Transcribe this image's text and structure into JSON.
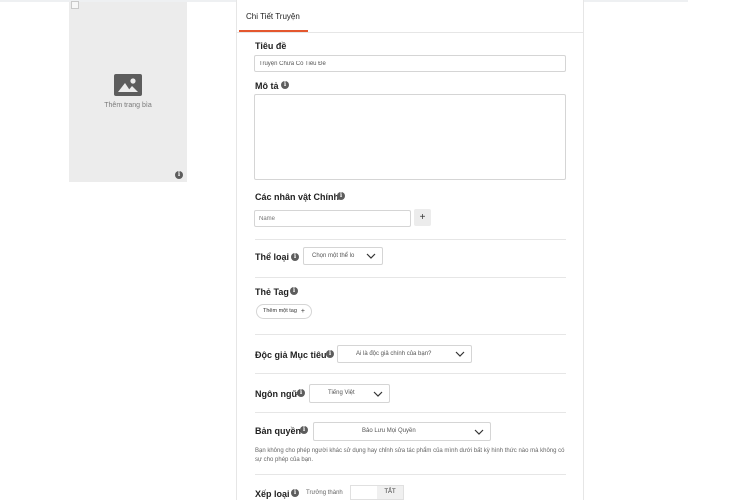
{
  "cover": {
    "add_cover_label": "Thêm trang bìa",
    "icon": "image-icon"
  },
  "tabs": [
    {
      "label": "Chi Tiết Truyện",
      "active": true
    }
  ],
  "form": {
    "title_label": "Tiêu đề",
    "title_value": "Truyện Chưa Có Tiêu Đề",
    "description_label": "Mô tả",
    "characters_label": "Các nhân vật Chính",
    "characters_placeholder": "Name",
    "add_character": "+",
    "genre_label": "Thể loại",
    "genre_value": "Chọn một thể lo",
    "tags_label": "Thẻ Tag",
    "add_tag_label": "Thêm một tag",
    "add_tag_plus": "+",
    "audience_label": "Độc giả Mục tiêu",
    "audience_value": "Ai là độc giả chính của bạn?",
    "language_label": "Ngôn ngữ",
    "language_value": "Tiếng Việt",
    "copyright_label": "Bản quyền",
    "copyright_value": "Bảo Lưu Mọi Quyền",
    "copyright_help": "Bạn không cho phép người khác sử dụng hay chỉnh sửa tác phẩm của mình dưới bất kỳ hình thức nào mà không có sự cho phép của bạn.",
    "rating_label": "Xếp loại",
    "rating_text": "Trưởng thành",
    "rating_toggle": "TẮT"
  },
  "colors": {
    "accent": "#e4572e",
    "panel": "#ececec"
  }
}
